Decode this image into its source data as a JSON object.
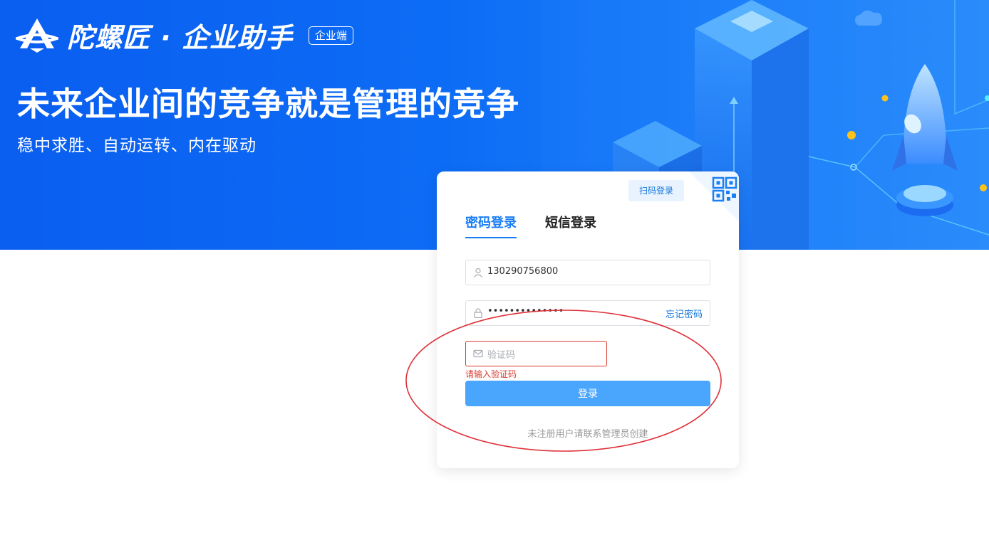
{
  "brand": {
    "name": "陀螺匠 · 企业助手",
    "badge": "企业端"
  },
  "hero": {
    "headline": "未来企业间的竞争就是管理的竞争",
    "subline": "稳中求胜、自动运转、内在驱动"
  },
  "login": {
    "qr_tip": "扫码登录",
    "tabs": [
      {
        "label": "密码登录",
        "active": true
      },
      {
        "label": "短信登录",
        "active": false
      }
    ],
    "username": {
      "value": "130290756800",
      "icon": "user-icon"
    },
    "password": {
      "value": "••••••••••••••",
      "icon": "lock-icon"
    },
    "forgot_label": "忘记密码",
    "captcha": {
      "placeholder": "验证码",
      "icon": "mail-icon",
      "value": ""
    },
    "captcha_error": "请输入验证码",
    "submit_label": "登录",
    "footer_note": "未注册用户请联系管理员创建"
  },
  "colors": {
    "primary": "#1a7ef5",
    "button": "#4aa5fd",
    "error": "#d9392b",
    "banner": "#0a5ef0"
  }
}
